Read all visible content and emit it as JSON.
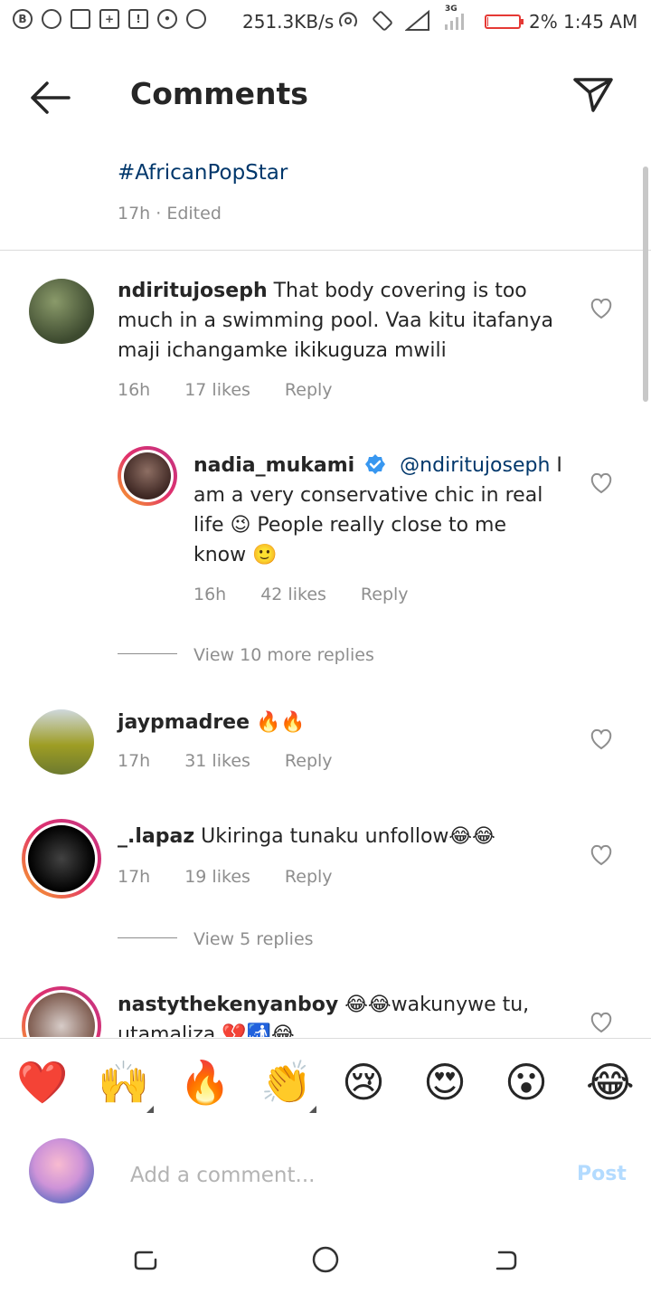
{
  "status_bar": {
    "speed": "251.3KB/s",
    "network": "3G",
    "battery_percent": "2%",
    "battery_level": 0.02,
    "time": "1:45 AM",
    "battery_color": "#e53935"
  },
  "header": {
    "title": "Comments",
    "back_icon": "arrow-left-icon",
    "send_icon": "paper-plane-icon"
  },
  "caption": {
    "hashtag": "#AfricanPopStar",
    "meta": "17h · Edited"
  },
  "comments": [
    {
      "username": "ndiritujoseph",
      "text": " That body covering is too much in a swimming pool. Vaa kitu itafanya maji ichangamke ikikuguza mwili",
      "time": "16h",
      "likes": "17 likes",
      "reply": "Reply"
    },
    {
      "username": "nadia_mukami",
      "verified": true,
      "mention": "@ndiritujoseph",
      "text": " I am a very conservative chic in real life 😉 People really close to me know 🙂",
      "time": "16h",
      "likes": "42 likes",
      "reply": "Reply"
    },
    {
      "username": "jaypmadree",
      "text": " 🔥🔥",
      "time": "17h",
      "likes": "31 likes",
      "reply": "Reply"
    },
    {
      "username": "_.lapaz",
      "text": " Ukiringa tunaku unfollow😂😂",
      "time": "17h",
      "likes": "19 likes",
      "reply": "Reply"
    },
    {
      "username": "nastythekenyanboy",
      "text": " 😂😂wakunywe tu, utamaliza 💔🚮😂"
    }
  ],
  "view_replies": {
    "first": "View 10 more replies",
    "second": "View 5 replies"
  },
  "emoji_bar": [
    "❤️",
    "🙌",
    "🔥",
    "👏",
    "😢",
    "😍",
    "😮",
    "😂"
  ],
  "input": {
    "placeholder": "Add a comment...",
    "value": "",
    "post_label": "Post",
    "post_color": "#b3dbff"
  },
  "colors": {
    "link": "#00376b",
    "muted": "#8e8e8e",
    "verified": "#3897f0"
  }
}
